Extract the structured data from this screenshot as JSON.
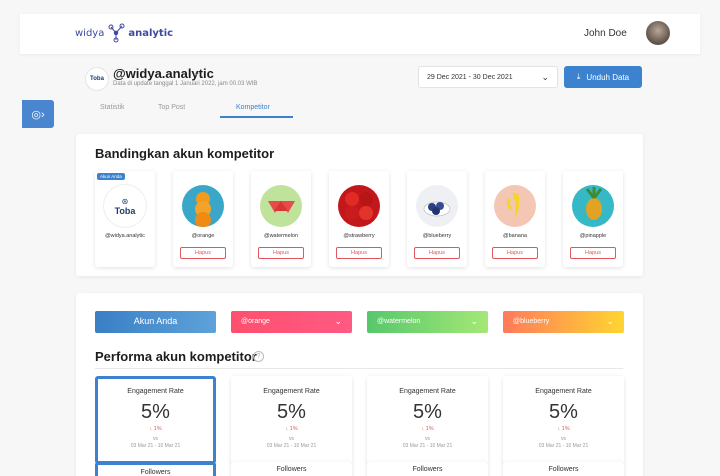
{
  "app": {
    "logo_left": "widya",
    "logo_right": "analytic",
    "user_name": "John Doe"
  },
  "account": {
    "handle": "@widya.analytic",
    "logo_text": "Toba",
    "updated": "Data di update tanggal 1 Januari 2022, jam 00.03 WIB"
  },
  "date_range": "29 Dec 2021 - 30 Dec 2021",
  "download_label": "Unduh Data",
  "tabs": [
    "Statistik",
    "Top Post",
    "Kompetitor"
  ],
  "compare": {
    "title": "Bandingkan akun kompetitor",
    "badge": "Akun Anda",
    "remove_label": "Hapus",
    "accounts": [
      {
        "name": "@widya.analytic",
        "color": "#ffffff"
      },
      {
        "name": "@orange",
        "color": "#f39a1e"
      },
      {
        "name": "@watermelon",
        "color": "#8bcf52"
      },
      {
        "name": "@strawberry",
        "color": "#d8201e"
      },
      {
        "name": "@blueberry",
        "color": "#3b52a0"
      },
      {
        "name": "@banana",
        "color": "#f2b8a4"
      },
      {
        "name": "@pinapple",
        "color": "#2fb2c3"
      }
    ]
  },
  "selectors": {
    "you": "Akun Anda",
    "items": [
      {
        "label": "@orange",
        "from": "#ff5a7d",
        "to": "#ff3f5f"
      },
      {
        "label": "@watermelon",
        "from": "#55c66a",
        "to": "#a3e874"
      },
      {
        "label": "@blueberry",
        "from": "#ff7d5a",
        "to": "#ffd332"
      }
    ]
  },
  "performance": {
    "title": "Performa akun kompetitor",
    "help": "?",
    "stats": [
      {
        "label": "Engagement Rate",
        "value": "5%",
        "change": "↓ 1%",
        "vs": "vs",
        "range": "03 Mar 21 - 10 Mar 21"
      },
      {
        "label": "Engagement Rate",
        "value": "5%",
        "change": "↓ 1%",
        "vs": "vs",
        "range": "03 Mar 21 - 10 Mar 21"
      },
      {
        "label": "Engagement Rate",
        "value": "5%",
        "change": "↓ 1%",
        "vs": "vs",
        "range": "03 Mar 21 - 10 Mar 21"
      },
      {
        "label": "Engagement Rate",
        "value": "5%",
        "change": "↓ 1%",
        "vs": "vs",
        "range": "03 Mar 21 - 10 Mar 21"
      }
    ],
    "second_row_label": "Followers"
  }
}
